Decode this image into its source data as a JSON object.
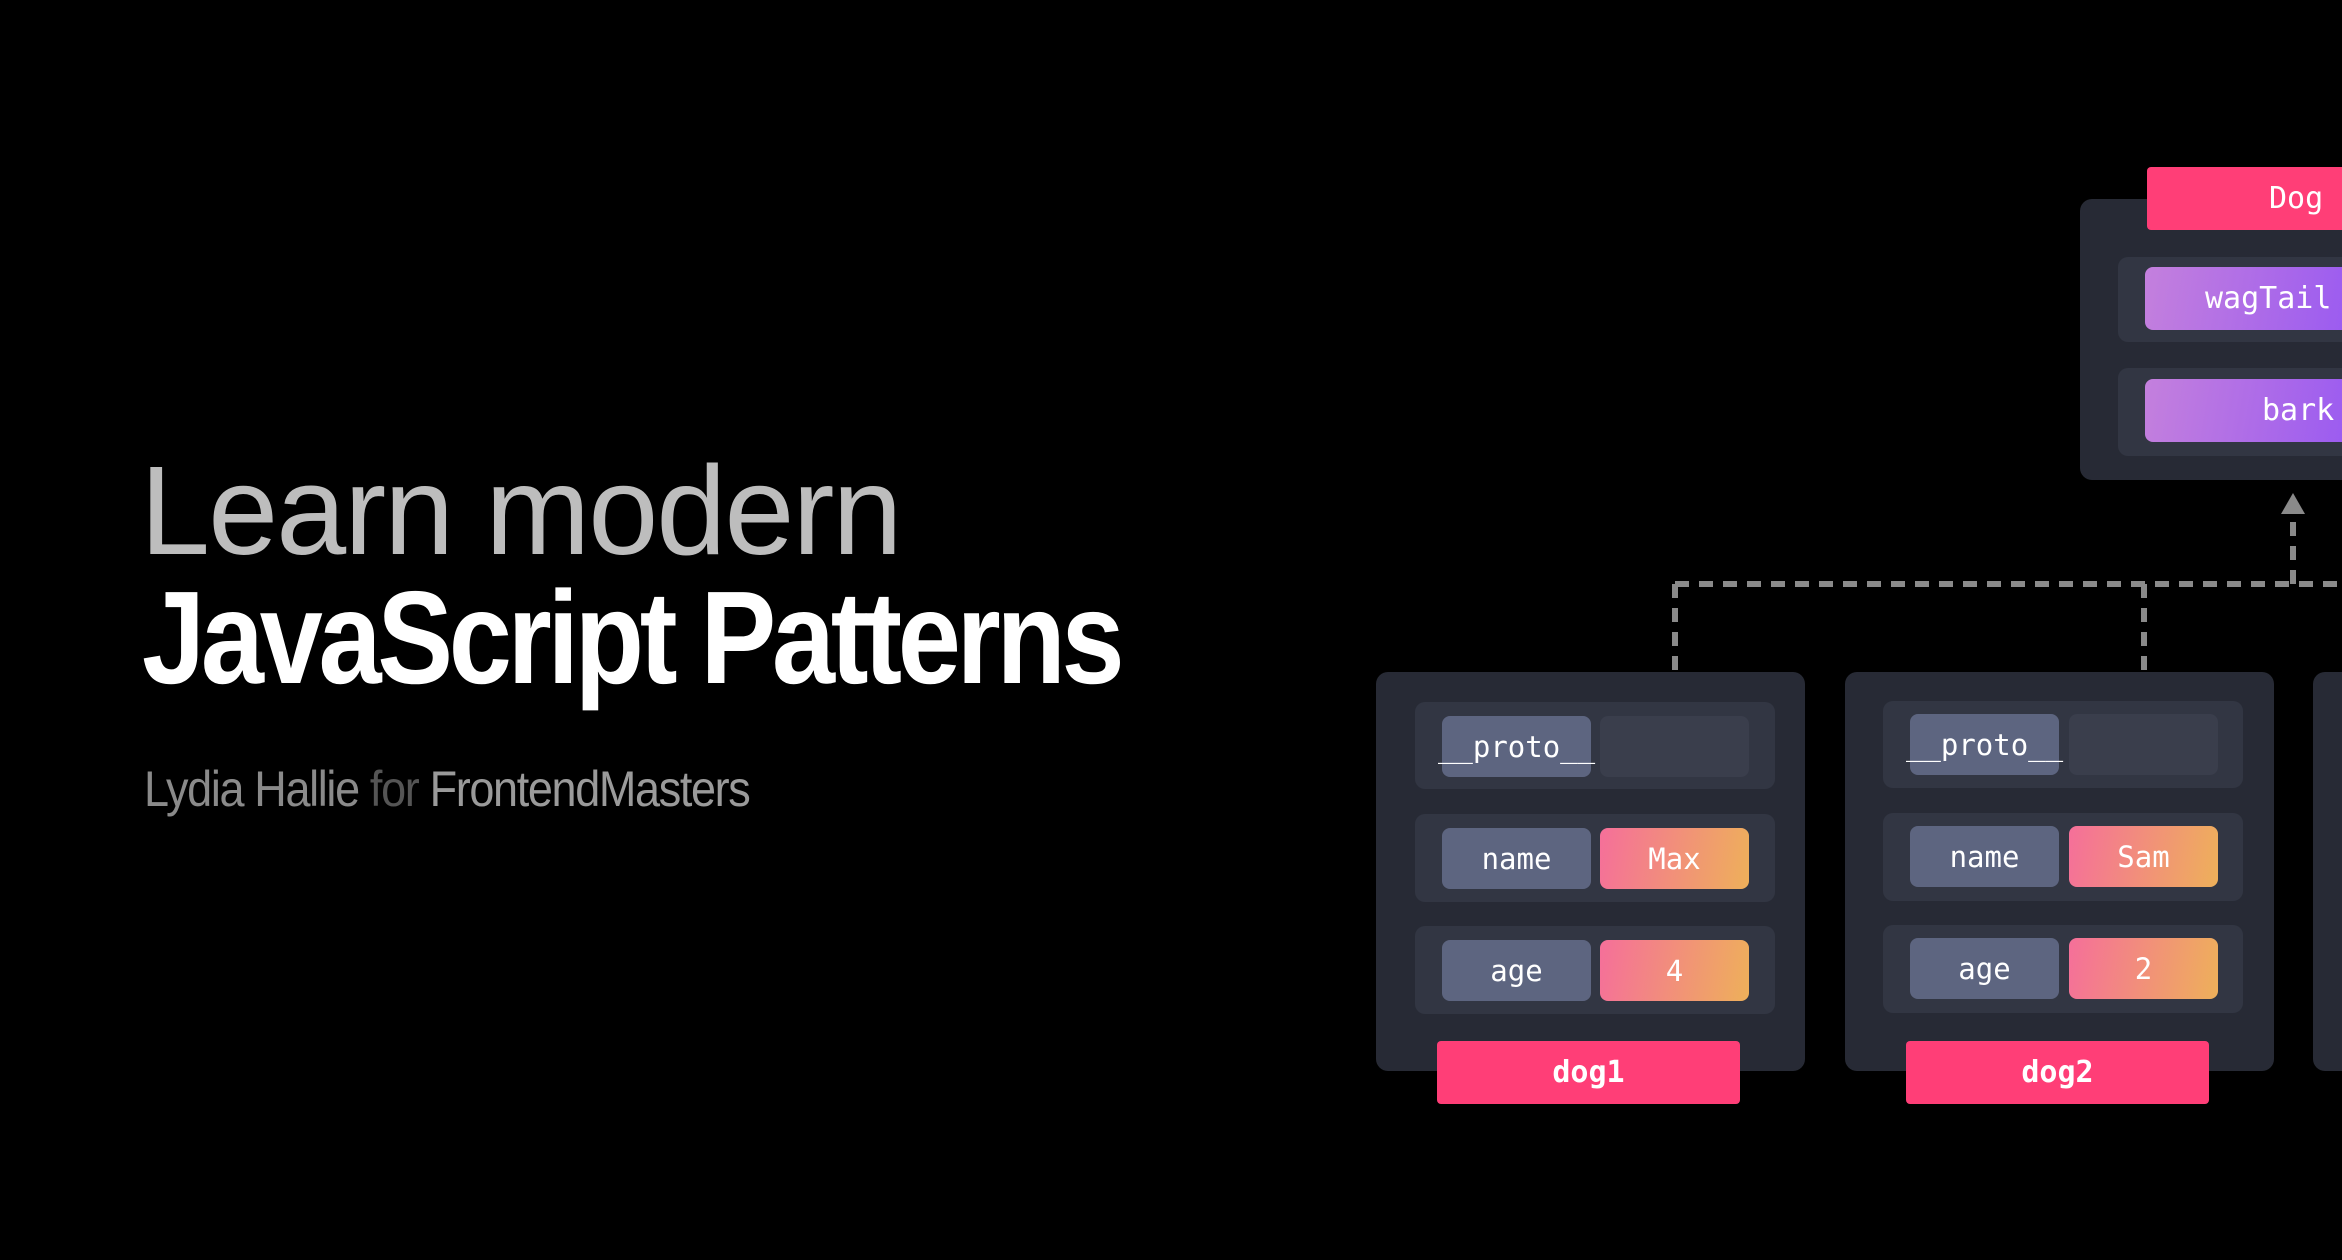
{
  "headline": {
    "line1": "Learn modern",
    "line2": "JavaScript Patterns"
  },
  "byline": {
    "author": "Lydia Hallie",
    "connector": "for",
    "org": "FrontendMasters"
  },
  "diagram": {
    "prototype": {
      "label": "Dog",
      "methods": [
        "wagTail",
        "bark"
      ]
    },
    "instances": [
      {
        "label": "dog1",
        "proto_key": "__proto__",
        "props": [
          {
            "key": "name",
            "value": "Max"
          },
          {
            "key": "age",
            "value": "4"
          }
        ]
      },
      {
        "label": "dog2",
        "proto_key": "__proto__",
        "props": [
          {
            "key": "name",
            "value": "Sam"
          },
          {
            "key": "age",
            "value": "2"
          }
        ]
      }
    ]
  },
  "colors": {
    "label": "#ff3e77",
    "key": "#5d6580",
    "value_gradient": [
      "#f56f9a",
      "#eeb05a"
    ],
    "method_gradient": [
      "#c480dd",
      "#9c5cf0"
    ],
    "link": "#8a8a8a"
  }
}
